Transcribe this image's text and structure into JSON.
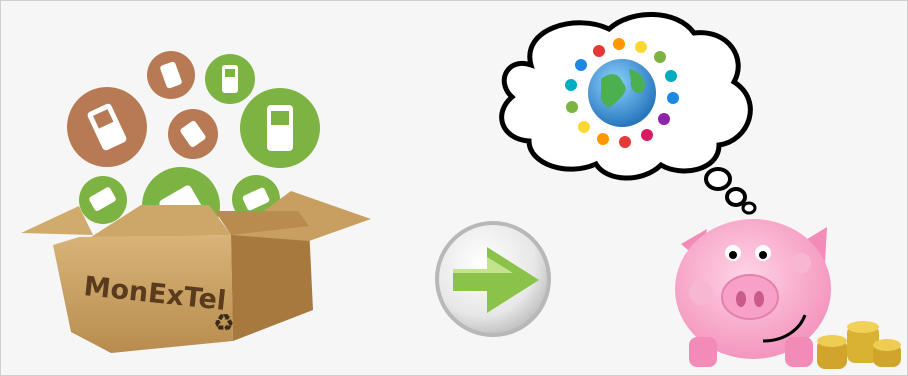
{
  "box": {
    "label": "MonExTel",
    "recycle_symbol": "♻"
  },
  "icons": {
    "phones": [
      "phone-icon",
      "phone-icon",
      "phone-icon",
      "phone-icon",
      "phone-icon",
      "phone-icon",
      "phone-icon",
      "phone-icon",
      "phone-icon"
    ],
    "arrow": "arrow-right-icon",
    "globe": "globe-icon",
    "piggy": "piggy-bank-icon",
    "coins": "coin-stack-icon"
  },
  "colors": {
    "brown_circle": "#b87a55",
    "green_circle": "#7cb342",
    "box": "#c9a56a",
    "arrow": "#8bc34a",
    "piggy": "#f7a8c8"
  }
}
